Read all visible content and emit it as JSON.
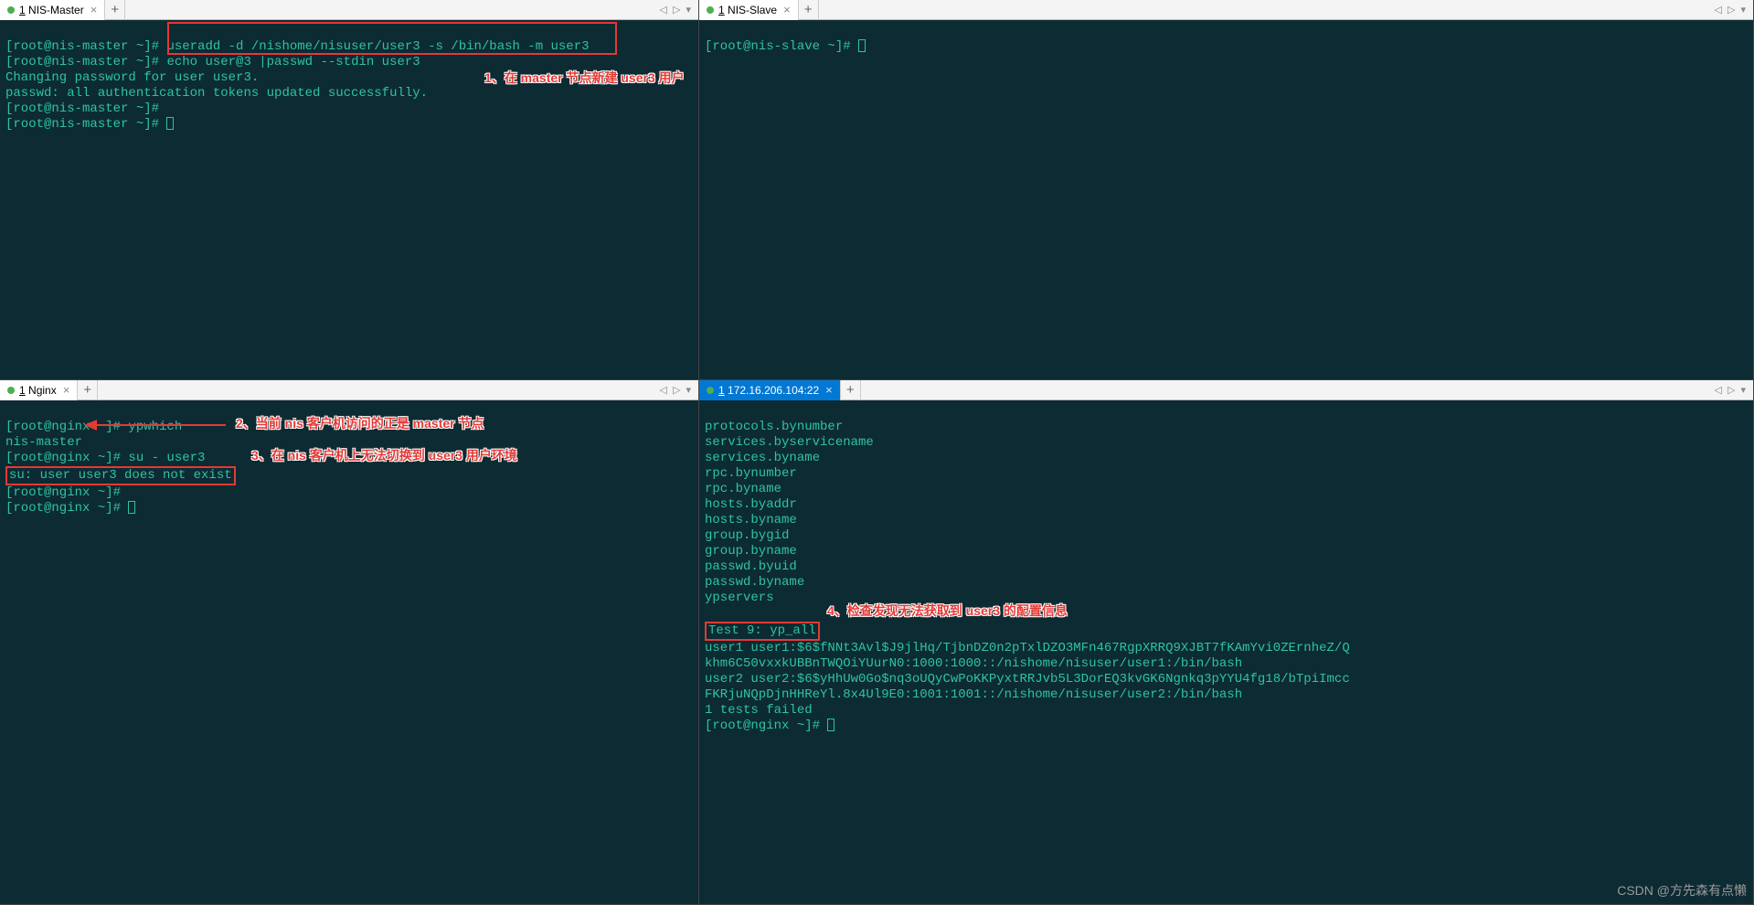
{
  "panes": {
    "topLeft": {
      "tab": {
        "index": "1",
        "title": "NIS-Master"
      },
      "lines": {
        "p1": "[root@nis-master ~]# ",
        "c1": "useradd -d /nishome/nisuser/user3 -s /bin/bash -m user3",
        "p2": "[root@nis-master ~]# ",
        "c2": "echo user@3 |passwd --stdin user3",
        "l3": "Changing password for user user3.",
        "l4": "passwd: all authentication tokens updated successfully.",
        "p5": "[root@nis-master ~]#",
        "p6": "[root@nis-master ~]# "
      },
      "annotation1": "1、在 master 节点新建 user3 用户"
    },
    "topRight": {
      "tab": {
        "index": "1",
        "title": "NIS-Slave"
      },
      "lines": {
        "p1": "[root@nis-slave ~]# "
      }
    },
    "bottomLeft": {
      "tab": {
        "index": "1",
        "title": "Nginx"
      },
      "lines": {
        "p1": "[root@nginx ~]# ",
        "c1": "ypwhich",
        "l2": "nis-master",
        "p3": "[root@nginx ~]# ",
        "c3": "su - user3",
        "l4": "su: user user3 does not exist",
        "p5": "[root@nginx ~]#",
        "p6": "[root@nginx ~]# "
      },
      "annotation2": "2、当前 nis 客户机访问的正是 master 节点",
      "annotation3": "3、在 nis 客户机上无法切换到 user3 用户环境"
    },
    "bottomRight": {
      "tab": {
        "index": "1",
        "title": "172.16.206.104:22"
      },
      "lines": {
        "l1": "protocols.bynumber",
        "l2": "services.byservicename",
        "l3": "services.byname",
        "l4": "rpc.bynumber",
        "l5": "rpc.byname",
        "l6": "hosts.byaddr",
        "l7": "hosts.byname",
        "l8": "group.bygid",
        "l9": "group.byname",
        "l10": "passwd.byuid",
        "l11": "passwd.byname",
        "l12": "ypservers",
        "l13": "",
        "l14": "Test 9: yp_all",
        "l15": "user1 user1:$6$fNNt3Avl$J9jlHq/TjbnDZ0n2pTxlDZO3MFn467RgpXRRQ9XJBT7fKAmYvi0ZErnheZ/Q",
        "l16": "khm6C50vxxkUBBnTWQOiYUurN0:1000:1000::/nishome/nisuser/user1:/bin/bash",
        "l17": "user2 user2:$6$yHhUw0Go$nq3oUQyCwPoKKPyxtRRJvb5L3DorEQ3kvGK6Ngnkq3pYYU4fg18/bTpiImcc",
        "l18": "FKRjuNQpDjnHHReYl.8x4Ul9E0:1001:1001::/nishome/nisuser/user2:/bin/bash",
        "l19": "1 tests failed",
        "p20": "[root@nginx ~]# "
      },
      "annotation4": "4、检查发现无法获取到 user3 的配置信息"
    }
  },
  "watermark": "CSDN @方先森有点懒"
}
